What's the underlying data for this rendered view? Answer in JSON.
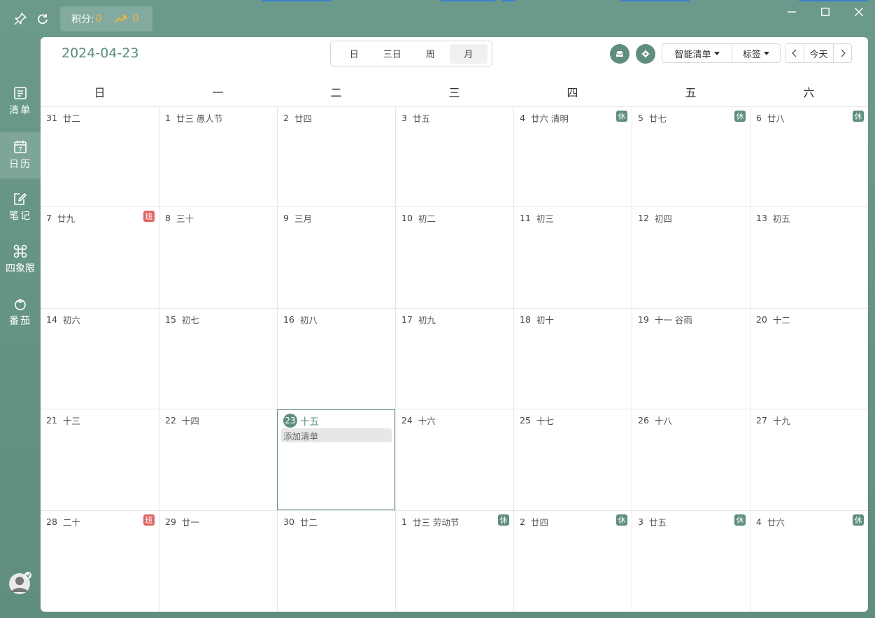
{
  "topbar": {
    "points_label": "积分:",
    "points_value": "0",
    "trend_value": "0"
  },
  "sidebar": {
    "items": [
      {
        "label": "清单",
        "icon": "list-icon"
      },
      {
        "label": "日历",
        "icon": "calendar-icon",
        "icon_text": "7"
      },
      {
        "label": "笔记",
        "icon": "note-icon"
      },
      {
        "label": "四象限",
        "icon": "quadrant-icon"
      },
      {
        "label": "番茄",
        "icon": "tomato-icon"
      }
    ]
  },
  "header": {
    "date": "2024-04-23",
    "view_tabs": [
      "日",
      "三日",
      "周",
      "月"
    ],
    "active_view": "月",
    "smart_list_label": "智能清单",
    "tags_label": "标签",
    "today_label": "今天"
  },
  "weekdays": [
    "日",
    "一",
    "二",
    "三",
    "四",
    "五",
    "六"
  ],
  "calendar": {
    "weeks": [
      [
        {
          "day": "31",
          "lunar": "廿二"
        },
        {
          "day": "1",
          "lunar": "廿三 愚人节"
        },
        {
          "day": "2",
          "lunar": "廿四"
        },
        {
          "day": "3",
          "lunar": "廿五"
        },
        {
          "day": "4",
          "lunar": "廿六 清明",
          "badge": "休"
        },
        {
          "day": "5",
          "lunar": "廿七",
          "badge": "休"
        },
        {
          "day": "6",
          "lunar": "廿八",
          "badge": "休"
        }
      ],
      [
        {
          "day": "7",
          "lunar": "廿九",
          "badge": "班"
        },
        {
          "day": "8",
          "lunar": "三十"
        },
        {
          "day": "9",
          "lunar": "三月"
        },
        {
          "day": "10",
          "lunar": "初二"
        },
        {
          "day": "11",
          "lunar": "初三"
        },
        {
          "day": "12",
          "lunar": "初四"
        },
        {
          "day": "13",
          "lunar": "初五"
        }
      ],
      [
        {
          "day": "14",
          "lunar": "初六"
        },
        {
          "day": "15",
          "lunar": "初七"
        },
        {
          "day": "16",
          "lunar": "初八"
        },
        {
          "day": "17",
          "lunar": "初九"
        },
        {
          "day": "18",
          "lunar": "初十"
        },
        {
          "day": "19",
          "lunar": "十一 谷雨"
        },
        {
          "day": "20",
          "lunar": "十二"
        }
      ],
      [
        {
          "day": "21",
          "lunar": "十三"
        },
        {
          "day": "22",
          "lunar": "十四"
        },
        {
          "day": "23",
          "lunar": "十五",
          "today": true,
          "add_label": "添加清单"
        },
        {
          "day": "24",
          "lunar": "十六"
        },
        {
          "day": "25",
          "lunar": "十七"
        },
        {
          "day": "26",
          "lunar": "十八"
        },
        {
          "day": "27",
          "lunar": "十九"
        }
      ],
      [
        {
          "day": "28",
          "lunar": "二十",
          "badge": "班"
        },
        {
          "day": "29",
          "lunar": "廿一"
        },
        {
          "day": "30",
          "lunar": "廿二"
        },
        {
          "day": "1",
          "lunar": "廿三 劳动节",
          "badge": "休"
        },
        {
          "day": "2",
          "lunar": "廿四",
          "badge": "休"
        },
        {
          "day": "3",
          "lunar": "廿五",
          "badge": "休"
        },
        {
          "day": "4",
          "lunar": "廿六",
          "badge": "休"
        }
      ]
    ]
  },
  "colors": {
    "accent": "#5f8e80",
    "rest_badge": "#5f8e80",
    "work_badge": "#e06666",
    "points": "#f2b441"
  }
}
